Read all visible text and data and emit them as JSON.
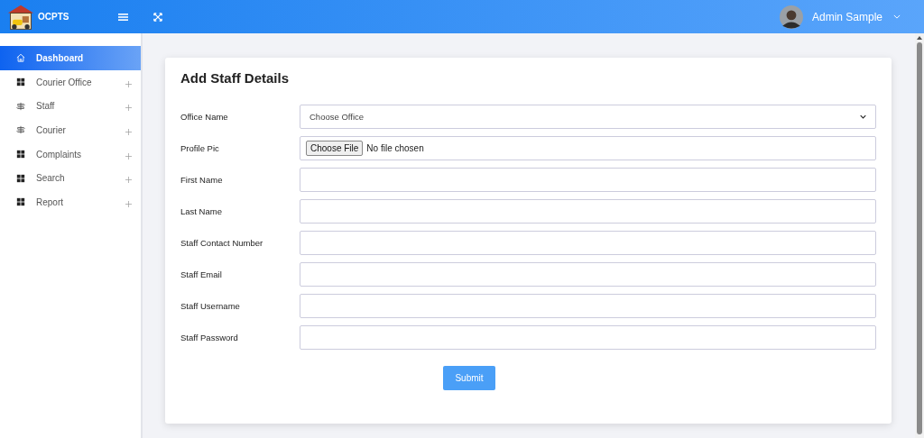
{
  "brand": {
    "name": "OCPTS"
  },
  "user": {
    "name": "Admin Sample"
  },
  "sidebar": {
    "items": [
      {
        "label": "Dashboard",
        "kind": "home",
        "selected": true,
        "expandable": false
      },
      {
        "label": "Courier Office",
        "kind": "grid",
        "selected": false,
        "expandable": true
      },
      {
        "label": "Staff",
        "kind": "sign",
        "selected": false,
        "expandable": true
      },
      {
        "label": "Courier",
        "kind": "sign",
        "selected": false,
        "expandable": true
      },
      {
        "label": "Complaints",
        "kind": "grid",
        "selected": false,
        "expandable": true
      },
      {
        "label": "Search",
        "kind": "grid",
        "selected": false,
        "expandable": true
      },
      {
        "label": "Report",
        "kind": "grid",
        "selected": false,
        "expandable": true
      }
    ]
  },
  "form": {
    "title": "Add Staff Details",
    "fields": [
      {
        "label": "Office Name",
        "kind": "select",
        "value": "Choose Office"
      },
      {
        "label": "Profile Pic",
        "kind": "file",
        "button": "Choose File",
        "value": "No file chosen"
      },
      {
        "label": "First Name",
        "kind": "text"
      },
      {
        "label": "Last Name",
        "kind": "text"
      },
      {
        "label": "Staff Contact Number",
        "kind": "text"
      },
      {
        "label": "Staff Email",
        "kind": "text"
      },
      {
        "label": "Staff Username",
        "kind": "text"
      },
      {
        "label": "Staff Password",
        "kind": "text"
      }
    ],
    "submit": "Submit"
  }
}
